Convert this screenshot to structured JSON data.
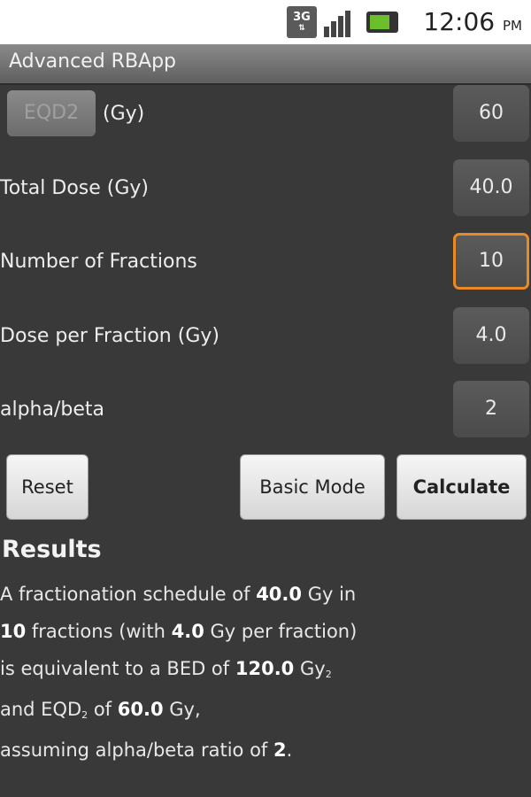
{
  "status_bar": {
    "network_label": "3G",
    "time": "12:06",
    "time_suffix": "PM"
  },
  "title_bar": {
    "title": "Advanced RBApp"
  },
  "form": {
    "eqd2_spinner_label": "EQD2",
    "eqd2_unit": "(Gy)",
    "eqd2_value": "60",
    "total_dose_label": "Total Dose (Gy)",
    "total_dose_value": "40.0",
    "fractions_label": "Number of Fractions",
    "fractions_value": "10",
    "dose_per_fraction_label": "Dose per Fraction (Gy)",
    "dose_per_fraction_value": "4.0",
    "alpha_beta_label": "alpha/beta",
    "alpha_beta_value": "2"
  },
  "buttons": {
    "reset": "Reset",
    "basic_mode": "Basic Mode",
    "calculate": "Calculate"
  },
  "results": {
    "title": "Results",
    "line1_a": "A fractionation schedule of ",
    "total_dose": "40.0",
    "line1_b": " Gy in",
    "fractions": "10",
    "line2_a": " fractions (with ",
    "dose_per_fraction": "4.0",
    "line2_b": " Gy per fraction)",
    "line3_a": "is equivalent to a BED of ",
    "bed": "120.0",
    "line3_b": " Gy",
    "bed_subscript": "2",
    "line4_a": "and EQD",
    "eqd_subscript": "2",
    "line4_b": " of ",
    "eqd2": "60.0",
    "line4_c": " Gy,",
    "line5_a": "assuming alpha/beta ratio of ",
    "alpha_beta": "2",
    "line5_b": "."
  },
  "colors": {
    "background": "#393939",
    "focus_border": "#e98a23",
    "battery_fill": "#6bbf2a"
  }
}
